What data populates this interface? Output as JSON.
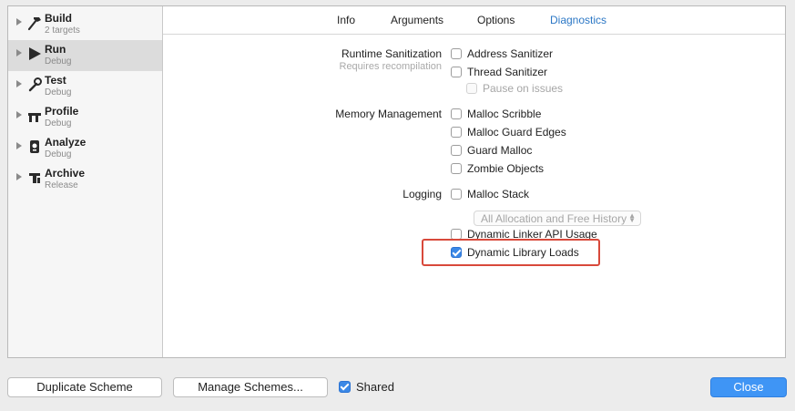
{
  "sidebar": {
    "items": [
      {
        "title": "Build",
        "subtitle": "2 targets",
        "icon": "hammer-icon"
      },
      {
        "title": "Run",
        "subtitle": "Debug",
        "icon": "play-icon"
      },
      {
        "title": "Test",
        "subtitle": "Debug",
        "icon": "wrench-icon"
      },
      {
        "title": "Profile",
        "subtitle": "Debug",
        "icon": "instruments-icon"
      },
      {
        "title": "Analyze",
        "subtitle": "Debug",
        "icon": "analyze-icon"
      },
      {
        "title": "Archive",
        "subtitle": "Release",
        "icon": "archive-icon"
      }
    ],
    "selected": "Run"
  },
  "tabs": [
    {
      "label": "Info"
    },
    {
      "label": "Arguments"
    },
    {
      "label": "Options"
    },
    {
      "label": "Diagnostics",
      "active": true
    }
  ],
  "diagnostics": {
    "runtime_sanitization": {
      "label": "Runtime Sanitization",
      "note": "Requires recompilation",
      "address_sanitizer": {
        "label": "Address Sanitizer",
        "checked": false
      },
      "thread_sanitizer": {
        "label": "Thread Sanitizer",
        "checked": false
      },
      "pause_on_issues": {
        "label": "Pause on issues",
        "checked": false,
        "enabled": false
      }
    },
    "memory_management": {
      "label": "Memory Management",
      "malloc_scribble": {
        "label": "Malloc Scribble",
        "checked": false
      },
      "malloc_guard_edges": {
        "label": "Malloc Guard Edges",
        "checked": false
      },
      "guard_malloc": {
        "label": "Guard Malloc",
        "checked": false
      },
      "zombie_objects": {
        "label": "Zombie Objects",
        "checked": false
      }
    },
    "logging": {
      "label": "Logging",
      "malloc_stack": {
        "label": "Malloc Stack",
        "checked": false
      },
      "history_popup": {
        "value": "All Allocation and Free History",
        "enabled": false
      },
      "dynamic_linker_api_usage": {
        "label": "Dynamic Linker API Usage",
        "checked": false
      },
      "dynamic_library_loads": {
        "label": "Dynamic Library Loads",
        "checked": true
      }
    }
  },
  "footer": {
    "duplicate_label": "Duplicate Scheme",
    "manage_label": "Manage Schemes...",
    "shared_label": "Shared",
    "shared_checked": true,
    "close_label": "Close"
  },
  "colors": {
    "accent": "#3f95f5",
    "active_tab": "#2b77c5",
    "highlight": "#d8493b"
  }
}
